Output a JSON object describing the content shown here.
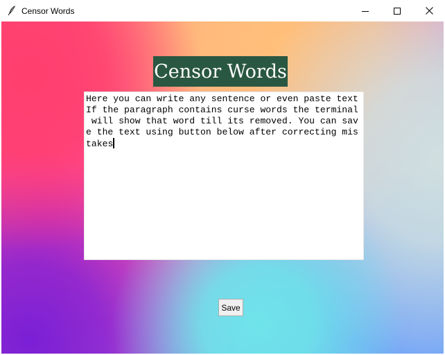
{
  "window": {
    "title": "Censor Words",
    "icon": "feather-icon",
    "controls": {
      "minimize": "minimize-icon",
      "maximize": "maximize-icon",
      "close": "close-icon"
    }
  },
  "heading": {
    "text": "Censor Words",
    "background": "#2a5741",
    "color": "#ffffff"
  },
  "editor": {
    "lines": [
      "Here you can write any sentence or even paste text",
      "If the paragraph contains curse words the terminal",
      " will show that word till its removed. You can sav",
      "e the text using button below after correcting mis",
      "takes"
    ]
  },
  "save_button": {
    "label": "Save"
  }
}
